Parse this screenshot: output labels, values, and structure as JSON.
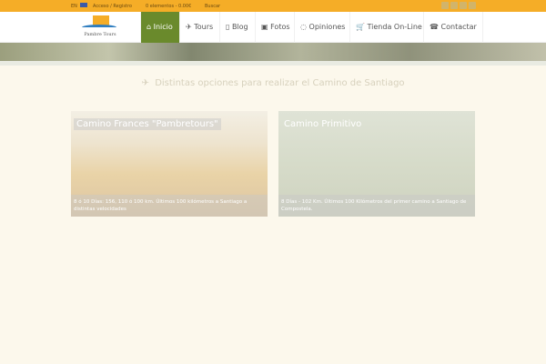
{
  "topbar": {
    "lang": "EN",
    "login": "Acceso / Registro",
    "cart": "0 elementos - 0.00€",
    "search": "Buscar",
    "social": [
      "rss-icon",
      "email-icon",
      "twitter-icon",
      "facebook-icon"
    ]
  },
  "logo": {
    "text": "Pambre Tours"
  },
  "nav": [
    {
      "label": "Inicio",
      "icon": "⌂"
    },
    {
      "label": "Tours",
      "icon": "✈"
    },
    {
      "label": "Blog",
      "icon": "▯"
    },
    {
      "label": "Fotos",
      "icon": "▣"
    },
    {
      "label": "Opiniones",
      "icon": "◌"
    },
    {
      "label": "Tienda On-Line",
      "icon": "🛒"
    },
    {
      "label": "Contactar",
      "icon": "☎"
    }
  ],
  "heading": "Distintas opciones para realizar el Camino de Santiago",
  "cards": [
    {
      "title": "Camino Frances \"Pambretours\"",
      "desc": "8 ó 10 Días: 156, 110 ó 100 km. Últimos 100 kilómetros a Santiago a distintas velocidades"
    },
    {
      "title": "Camino Primitivo",
      "desc": "8 Días - 102 Km. Últimos 100 Kilómetros del primer camino a Santiago de Compostela."
    }
  ],
  "colors": {
    "accent": "#f5ad27",
    "active": "#6a8a2c"
  }
}
